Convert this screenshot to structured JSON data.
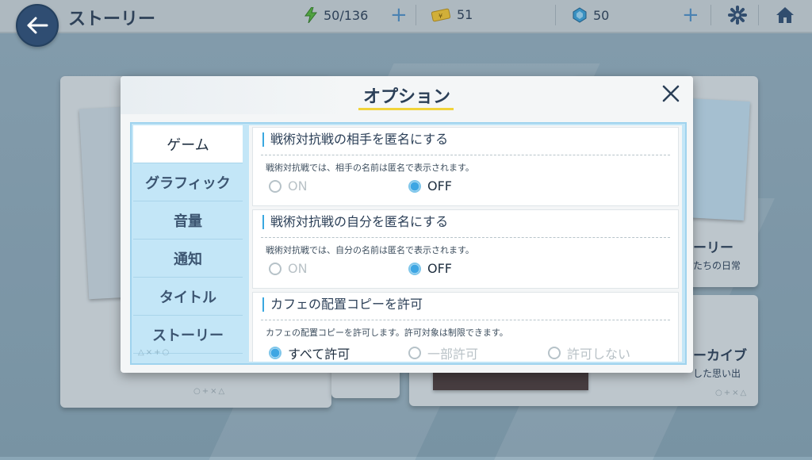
{
  "header": {
    "title": "ストーリー",
    "stamina": "50/136",
    "tickets": "51",
    "gems": "50"
  },
  "background_cards": {
    "left": {
      "deco": "○+×△"
    },
    "right_top": {
      "label": "ーリー",
      "sub": "たちの日常"
    },
    "right_bottom": {
      "label": "ーカイブ",
      "sub": "した思い出",
      "deco": "○+×△"
    }
  },
  "modal": {
    "title": "オプション",
    "tabs": [
      "ゲーム",
      "グラフィック",
      "音量",
      "通知",
      "タイトル",
      "ストーリー"
    ],
    "tabs_deco": "△×+○",
    "settings": [
      {
        "title": "戦術対抗戦の相手を匿名にする",
        "desc": "戦術対抗戦では、相手の名前は匿名で表示されます。",
        "options": [
          "ON",
          "OFF"
        ],
        "selected": "OFF"
      },
      {
        "title": "戦術対抗戦の自分を匿名にする",
        "desc": "戦術対抗戦では、自分の名前は匿名で表示されます。",
        "options": [
          "ON",
          "OFF"
        ],
        "selected": "OFF"
      },
      {
        "title": "カフェの配置コピーを許可",
        "desc": "カフェの配置コピーを許可します。許可対象は制限できます。",
        "options": [
          "すべて許可",
          "一部許可",
          "許可しない"
        ],
        "selected": "すべて許可"
      }
    ]
  },
  "colors": {
    "accent_blue": "#3ea6e3",
    "title_underline": "#f1d33a",
    "nav_dark": "#2f4d72"
  }
}
